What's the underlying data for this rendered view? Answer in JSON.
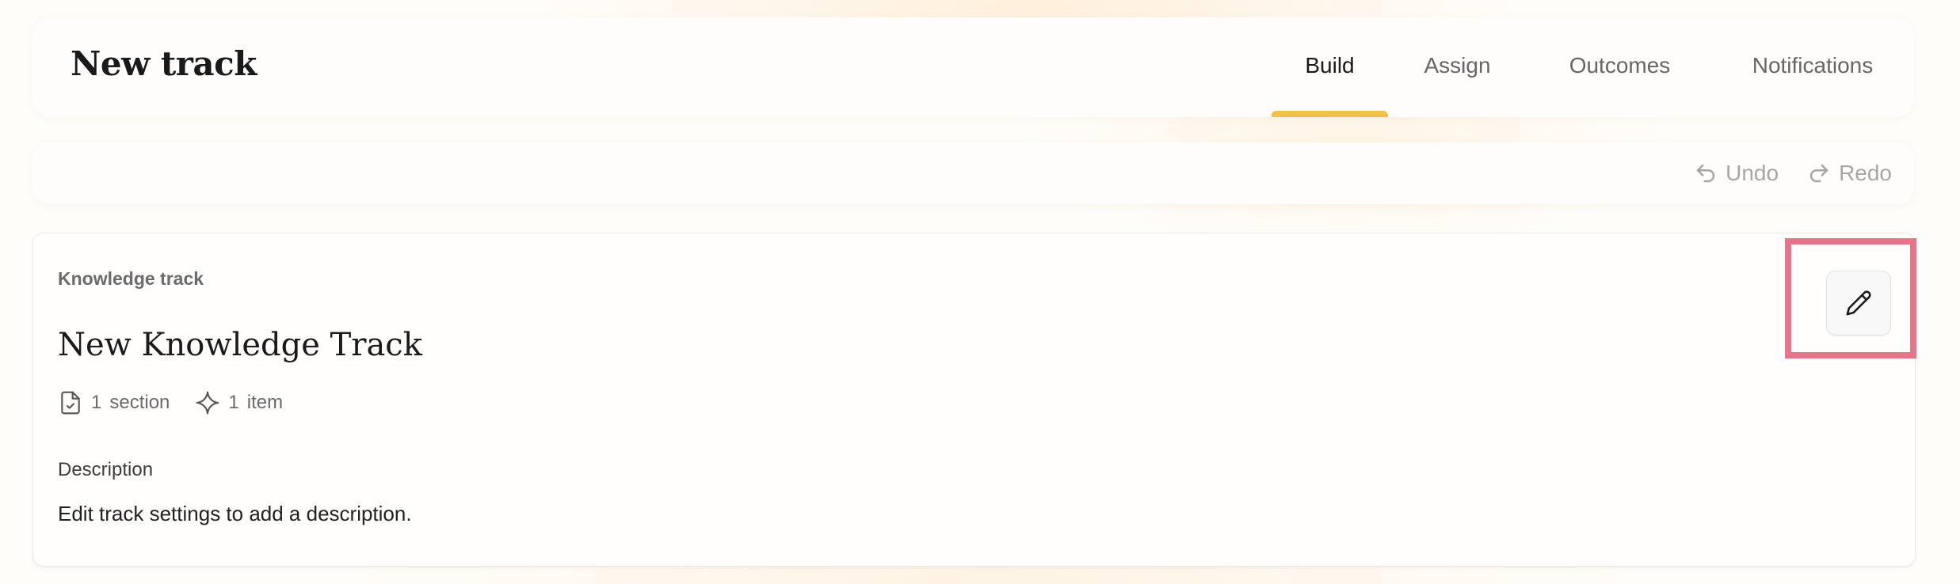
{
  "header": {
    "title": "New track",
    "tabs": [
      {
        "label": "Build",
        "active": true
      },
      {
        "label": "Assign",
        "active": false
      },
      {
        "label": "Outcomes",
        "active": false
      },
      {
        "label": "Notifications",
        "active": false
      }
    ]
  },
  "toolbar": {
    "undo": {
      "label": "Undo",
      "icon": "undo-icon"
    },
    "redo": {
      "label": "Redo",
      "icon": "redo-icon"
    }
  },
  "track": {
    "kicker": "Knowledge track",
    "title": "New Knowledge Track",
    "sections_count": "1",
    "sections_label": "section",
    "items_count": "1",
    "items_label": "item",
    "description_label": "Description",
    "description_text": "Edit track settings to add a description.",
    "edit_icon": "pencil-icon"
  },
  "colors": {
    "active_tab_indicator": "#f2c04a",
    "highlight_border": "#e8748a",
    "muted_text": "#a6a6a6"
  }
}
